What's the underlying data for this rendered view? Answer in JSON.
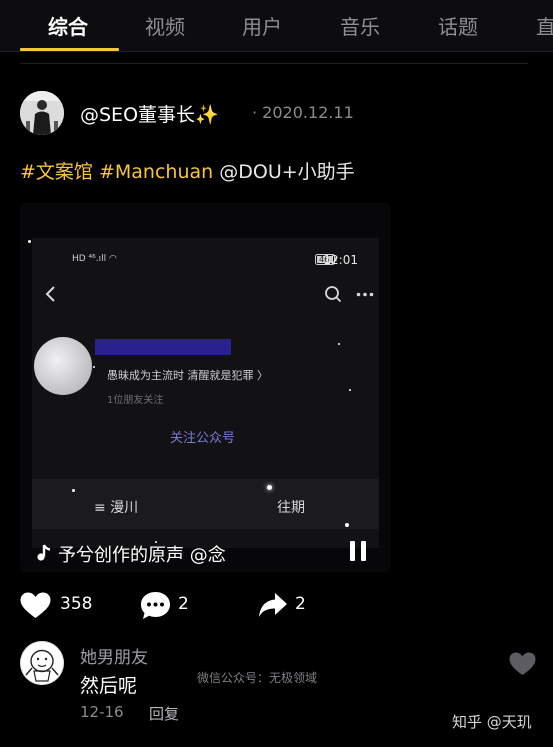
{
  "tabs": [
    {
      "label": "综合",
      "active": true
    },
    {
      "label": "视频",
      "active": false
    },
    {
      "label": "用户",
      "active": false
    },
    {
      "label": "音乐",
      "active": false
    },
    {
      "label": "话题",
      "active": false
    },
    {
      "label": "直",
      "active": false
    }
  ],
  "post": {
    "author": "@SEO董事长✨",
    "date": "2020.12.11",
    "caption": {
      "tag1": "#文案馆",
      "tag2": "#Manchuan",
      "mention": "@DOU+小助手"
    },
    "video": {
      "status_time": "12:01",
      "status_left": "HD ⁴⁶.ıll ◠",
      "status_battery": "46",
      "profile_bio": "愚昧成为主流时 清醒就是犯罪 〉",
      "profile_friends": "1位朋友关注",
      "follow_label": "关注公众号",
      "menu_item_1": "≡  漫川",
      "menu_item_2": "往期",
      "sound_text": "予兮创作的原声   @念"
    },
    "likes": "358",
    "comments": "2",
    "shares": "2"
  },
  "comment": {
    "name": "她男朋友",
    "text": "然后呢",
    "date": "12-16",
    "reply_label": "回复"
  },
  "watermarks": {
    "wechat": "微信公众号：无极领域",
    "zhihu": "知乎 @天玑"
  },
  "colors": {
    "accent": "#f7c53a",
    "background": "#000000",
    "name_bar": "#2a2190",
    "follow_link": "#7b7ad4"
  }
}
